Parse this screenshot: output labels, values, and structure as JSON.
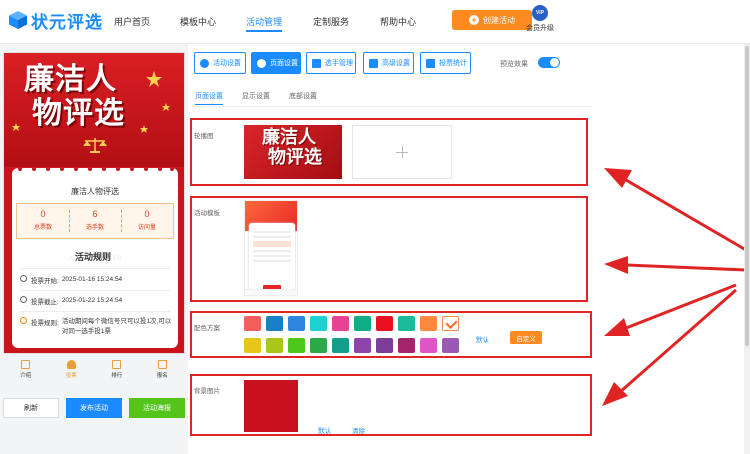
{
  "brand": {
    "name": "状元评选",
    "color": "#1a8cff"
  },
  "nav": [
    {
      "label": "用户首页",
      "active": false
    },
    {
      "label": "模板中心",
      "active": false
    },
    {
      "label": "活动管理",
      "active": true
    },
    {
      "label": "定制服务",
      "active": false
    },
    {
      "label": "帮助中心",
      "active": false
    }
  ],
  "header": {
    "create_label": "创建活动",
    "vip_badge": "VIP",
    "vip_label": "会员升级"
  },
  "preview": {
    "hero_title_line1": "廉洁人",
    "hero_title_line2": "物评选",
    "card_title": "廉洁人物评选",
    "stats": [
      {
        "value": "0",
        "label": "总票数"
      },
      {
        "value": "6",
        "label": "选手数"
      },
      {
        "value": "0",
        "label": "访问量"
      }
    ],
    "rules_title": "活动规则",
    "rules_ghost_left": "A",
    "rules_ghost_right": "ES",
    "rules": [
      {
        "label": "投票开始:",
        "value": "2025-01-16 15:24:54",
        "icon": "clock-icon"
      },
      {
        "label": "投票截止:",
        "value": "2025-01-22 15:24:54",
        "icon": "clock-icon"
      },
      {
        "label": "投票规则:",
        "value": "活动期间每个微信号只可以投1次,可以对同一选手投1票",
        "icon": "info-icon"
      }
    ],
    "tabs": [
      {
        "label": "介绍",
        "active": false
      },
      {
        "label": "投票",
        "active": true
      },
      {
        "label": "排行",
        "active": false
      },
      {
        "label": "报名",
        "active": false
      }
    ]
  },
  "actions": {
    "refresh": "刷新",
    "publish": "发布活动",
    "poster": "活动海报"
  },
  "toolbar": {
    "buttons": [
      {
        "label": "活动设置",
        "icon": "settings-icon",
        "active": false
      },
      {
        "label": "页面设置",
        "icon": "gear-icon",
        "active": true
      },
      {
        "label": "选手管理",
        "icon": "user-icon",
        "active": false
      },
      {
        "label": "高级设置",
        "icon": "sliders-icon",
        "active": false
      },
      {
        "label": "投票统计",
        "icon": "chart-icon",
        "active": false
      }
    ],
    "preview_label": "预览效果",
    "preview_on": true
  },
  "subtabs": [
    {
      "label": "页面设置",
      "active": true
    },
    {
      "label": "显示设置",
      "active": false
    },
    {
      "label": "底部设置",
      "active": false
    }
  ],
  "sections": {
    "carousel_label": "轮播图",
    "carousel_thumb_line1": "廉洁人",
    "carousel_thumb_line2": "物评选",
    "template_label": "活动模板",
    "color_label": "配色方案",
    "color_default": "默认",
    "color_custom": "自定义",
    "bg_label": "背景图片",
    "bg_default": "默认",
    "bg_clear": "清除"
  },
  "colors": {
    "row1": [
      "#f25f5c",
      "#1a7fc4",
      "#2e86de",
      "#1dd1d1",
      "#e84393",
      "#10ac84",
      "#e8101e",
      "#1abc9c",
      "#ff8a3d",
      "selected"
    ],
    "row2": [
      "#e6c619",
      "#a8c71a",
      "#4cc71a",
      "#2ba84a",
      "#139e8a",
      "#8e44ad",
      "#7d3c98",
      "#a3256b",
      "#e056c8",
      "#9b59b6"
    ],
    "bg_color": "#c8101e",
    "accent": "#ff8a1f",
    "annotation": "#e02424"
  }
}
